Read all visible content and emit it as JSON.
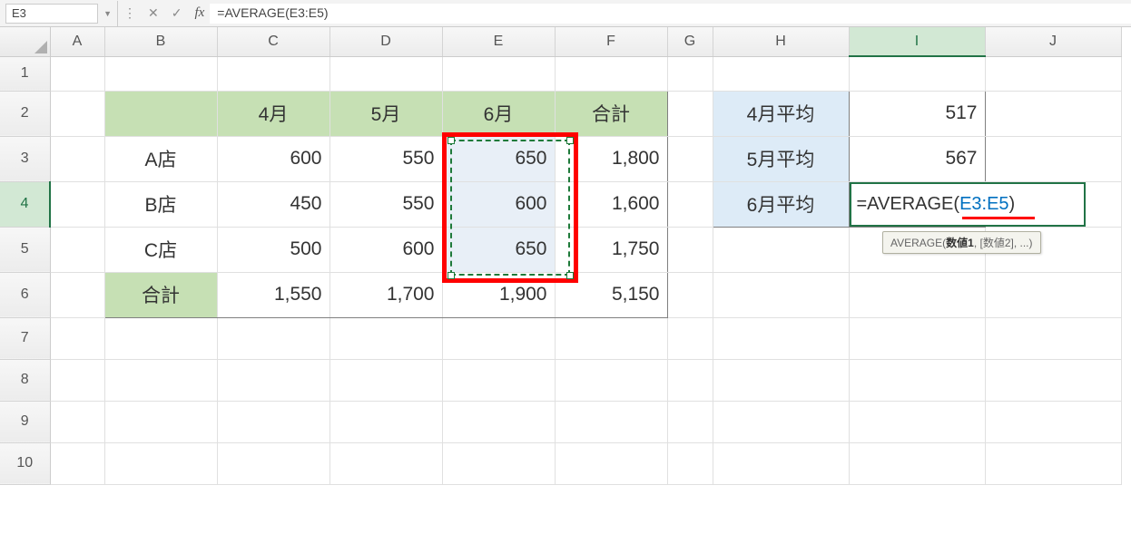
{
  "nameBox": "E3",
  "formulaBar": "=AVERAGE(E3:E5)",
  "columns": [
    "A",
    "B",
    "C",
    "D",
    "E",
    "F",
    "G",
    "H",
    "I",
    "J"
  ],
  "rows": [
    "1",
    "2",
    "3",
    "4",
    "5",
    "6",
    "7",
    "8",
    "9",
    "10"
  ],
  "main": {
    "headers": {
      "c": "4月",
      "d": "5月",
      "e": "6月",
      "f": "合計"
    },
    "r3": {
      "b": "A店",
      "c": "600",
      "d": "550",
      "e": "650",
      "f": "1,800"
    },
    "r4": {
      "b": "B店",
      "c": "450",
      "d": "550",
      "e": "600",
      "f": "1,600"
    },
    "r5": {
      "b": "C店",
      "c": "500",
      "d": "600",
      "e": "650",
      "f": "1,750"
    },
    "r6": {
      "b": "合計",
      "c": "1,550",
      "d": "1,700",
      "e": "1,900",
      "f": "5,150"
    }
  },
  "side": {
    "h2": "4月平均",
    "i2": "517",
    "h3": "5月平均",
    "i3": "567",
    "h4": "6月平均"
  },
  "editing": {
    "prefix": "=AVERAGE(",
    "ref": "E3:E5",
    "suffix": ")"
  },
  "tooltip": {
    "fn": "AVERAGE(",
    "arg1": "数値1",
    "rest": ", [数値2], ...)"
  }
}
